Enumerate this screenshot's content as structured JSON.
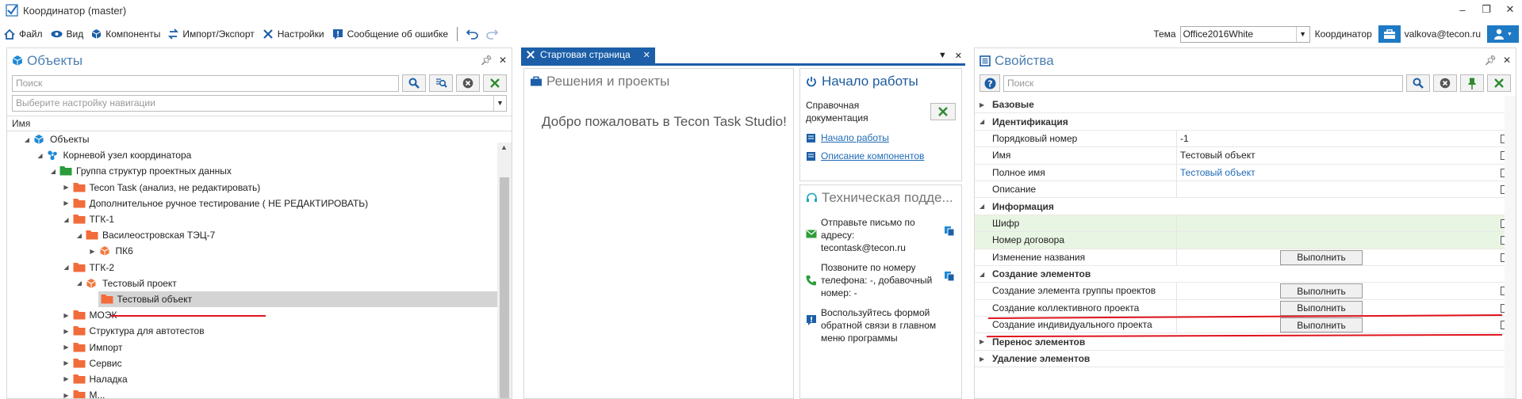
{
  "window": {
    "title": "Координатор (master)"
  },
  "toolbar": {
    "items": [
      "Файл",
      "Вид",
      "Компоненты",
      "Импорт/Экспорт",
      "Настройки",
      "Сообщение об ошибке"
    ],
    "theme_label": "Тема",
    "theme_value": "Office2016White",
    "coordinator_label": "Координатор",
    "user": "valkova@tecon.ru"
  },
  "objects": {
    "title": "Объекты",
    "search_placeholder": "Поиск",
    "nav_placeholder": "Выберите настройку навигации",
    "column_name": "Имя",
    "tree": [
      {
        "label": "Объекты",
        "level": 1,
        "expanded": true,
        "icon": "cube-blue"
      },
      {
        "label": "Корневой узел координатора",
        "level": 2,
        "expanded": true,
        "icon": "network-blue"
      },
      {
        "label": "Группа структур проектных данных",
        "level": 3,
        "expanded": true,
        "icon": "folder-green"
      },
      {
        "label": "Tecon Task (анализ, не редактировать)",
        "level": 4,
        "expanded": false,
        "icon": "folder-orange"
      },
      {
        "label": "Дополнительное ручное тестирование ( НЕ РЕДАКТИРОВАТЬ)",
        "level": 4,
        "expanded": false,
        "icon": "folder-orange"
      },
      {
        "label": "ТГК-1",
        "level": 4,
        "expanded": true,
        "icon": "folder-orange"
      },
      {
        "label": "Василеостровская ТЭЦ-7",
        "level": 5,
        "expanded": true,
        "icon": "folder-orange"
      },
      {
        "label": "ПК6",
        "level": 6,
        "expanded": false,
        "icon": "cube-orange"
      },
      {
        "label": "ТГК-2",
        "level": 4,
        "expanded": true,
        "icon": "folder-orange"
      },
      {
        "label": "Тестовый проект",
        "level": 5,
        "expanded": true,
        "icon": "cube-orange"
      },
      {
        "label": "Тестовый объект",
        "level": 6,
        "expanded": null,
        "icon": "folder-orange",
        "selected": true
      },
      {
        "label": "МОЭК",
        "level": 4,
        "expanded": false,
        "icon": "folder-orange"
      },
      {
        "label": "Структура для автотестов",
        "level": 4,
        "expanded": false,
        "icon": "folder-orange"
      },
      {
        "label": "Импорт",
        "level": 4,
        "expanded": false,
        "icon": "folder-orange"
      },
      {
        "label": "Сервис",
        "level": 4,
        "expanded": false,
        "icon": "folder-orange"
      },
      {
        "label": "Наладка",
        "level": 4,
        "expanded": false,
        "icon": "folder-orange"
      },
      {
        "label": "М...",
        "level": 4,
        "expanded": false,
        "icon": "folder-orange"
      }
    ]
  },
  "start": {
    "tab_label": "Стартовая страница",
    "solutions_title": "Решения и проекты",
    "welcome": "Добро пожаловать в Tecon Task Studio!",
    "getting_started_title": "Начало работы",
    "reference_docs_line1": "Справочная",
    "reference_docs_line2": "документация",
    "link_start": "Начало работы",
    "link_components": "Описание компонентов",
    "support_title": "Техническая подде...",
    "support_email": [
      "Отправьте письмо по",
      "адресу:",
      "tecontask@tecon.ru"
    ],
    "support_phone": [
      "Позвоните по номеру",
      "телефона: -, добавочный",
      "номер: -"
    ],
    "support_feedback": [
      "Воспользуйтесь формой",
      "обратной связи в главном",
      "меню программы"
    ]
  },
  "properties": {
    "title": "Свойства",
    "search_placeholder": "Поиск",
    "execute_label": "Выполнить",
    "rows": [
      {
        "type": "cat",
        "label": "Базовые",
        "expanded": false
      },
      {
        "type": "cat",
        "label": "Идентификация",
        "expanded": true
      },
      {
        "type": "prop",
        "label": "Порядковый номер",
        "value": "-1"
      },
      {
        "type": "prop",
        "label": "Имя",
        "value": "Тестовый объект"
      },
      {
        "type": "prop",
        "label": "Полное имя",
        "value": "Тестовый объект",
        "link": true
      },
      {
        "type": "prop",
        "label": "Описание",
        "value": ""
      },
      {
        "type": "cat",
        "label": "Информация",
        "expanded": true
      },
      {
        "type": "prop",
        "label": "Шифр",
        "value": "",
        "green": true
      },
      {
        "type": "prop",
        "label": "Номер договора",
        "value": "",
        "green": true
      },
      {
        "type": "prop",
        "label": "Изменение названия",
        "button": true
      },
      {
        "type": "cat",
        "label": "Создание элементов",
        "expanded": true
      },
      {
        "type": "prop",
        "label": "Создание элемента группы проектов",
        "button": true
      },
      {
        "type": "prop",
        "label": "Создание коллективного проекта",
        "button": true
      },
      {
        "type": "prop",
        "label": "Создание индивидуального проекта",
        "button": true
      },
      {
        "type": "cat",
        "label": "Перенос элементов",
        "expanded": false
      },
      {
        "type": "cat",
        "label": "Удаление элементов",
        "expanded": false
      }
    ]
  },
  "colors": {
    "accent": "#1c5fa8",
    "folder": "#f26b3a",
    "annotation": "#e0141e",
    "panel_title": "#4d7fb3"
  }
}
